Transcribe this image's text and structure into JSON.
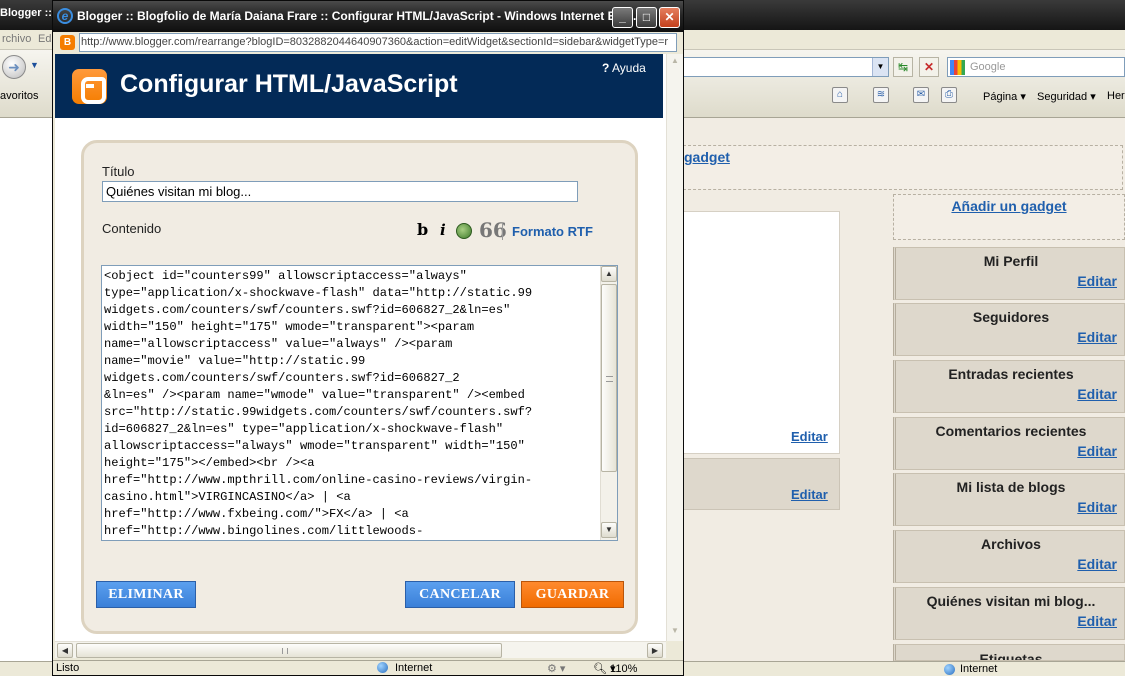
{
  "background_window": {
    "title": "Blogger :: B",
    "menu": [
      "rchivo",
      "Ed"
    ],
    "favorites_label": "avoritos",
    "search_placeholder": "Google",
    "command_items": {
      "page": "Página",
      "security": "Seguridad",
      "tools": "Her"
    },
    "gadget_link": "gadget",
    "add_gadget_link": "Añadir un gadget",
    "main_edit_links": [
      "Editar",
      "Editar"
    ],
    "sidebar_gadgets": [
      {
        "title": "Mi Perfil",
        "edit": "Editar"
      },
      {
        "title": "Seguidores",
        "edit": "Editar"
      },
      {
        "title": "Entradas recientes",
        "edit": "Editar"
      },
      {
        "title": "Comentarios recientes",
        "edit": "Editar"
      },
      {
        "title": "Mi lista de blogs",
        "edit": "Editar"
      },
      {
        "title": "Archivos",
        "edit": "Editar"
      },
      {
        "title": "Quiénes visitan mi blog...",
        "edit": "Editar"
      },
      {
        "title": "Etiquetas",
        "edit": ""
      }
    ],
    "status_zone": "Internet"
  },
  "popup": {
    "window_title": "Blogger :: Blogfolio de María Daiana Frare :: Configurar HTML/JavaScript - Windows Internet Expl...",
    "url": "http://www.blogger.com/rearrange?blogID=8032882044640907360&action=editWidget&sectionId=sidebar&widgetType=r",
    "header_title": "Configurar HTML/JavaScript",
    "help_label": "Ayuda",
    "help_mark": "?",
    "title_label": "Título",
    "title_value": "Quiénes visitan mi blog...",
    "content_label": "Contenido",
    "format_bold": "b",
    "format_italic": "i",
    "format_quote": "66",
    "format_rtf": "Formato RTF",
    "content_code": "<object id=\"counters99\" allowscriptaccess=\"always\"\ntype=\"application/x-shockwave-flash\" data=\"http://static.99\nwidgets.com/counters/swf/counters.swf?id=606827_2&ln=es\"\nwidth=\"150\" height=\"175\" wmode=\"transparent\"><param\nname=\"allowscriptaccess\" value=\"always\" /><param\nname=\"movie\" value=\"http://static.99\nwidgets.com/counters/swf/counters.swf?id=606827_2\n&ln=es\" /><param name=\"wmode\" value=\"transparent\" /><embed\nsrc=\"http://static.99widgets.com/counters/swf/counters.swf?\nid=606827_2&ln=es\" type=\"application/x-shockwave-flash\"\nallowscriptaccess=\"always\" wmode=\"transparent\" width=\"150\"\nheight=\"175\"></embed><br /><a\nhref=\"http://www.mpthrill.com/online-casino-reviews/virgin-\ncasino.html\">VIRGINCASINO</a> | <a\nhref=\"http://www.fxbeing.com/\">FX</a> | <a\nhref=\"http://www.bingolines.com/littlewoods-",
    "buttons": {
      "delete": "ELIMINAR",
      "cancel": "CANCELAR",
      "save": "GUARDAR"
    },
    "status_text": "Listo",
    "status_zone": "Internet",
    "status_zoom": "110%"
  },
  "colors": {
    "blogger_header": "#032a57",
    "blogger_orange": "#f57d00",
    "button_blue": "#3a7fd8",
    "button_orange": "#f06b00",
    "link_blue": "#1f5fad"
  }
}
